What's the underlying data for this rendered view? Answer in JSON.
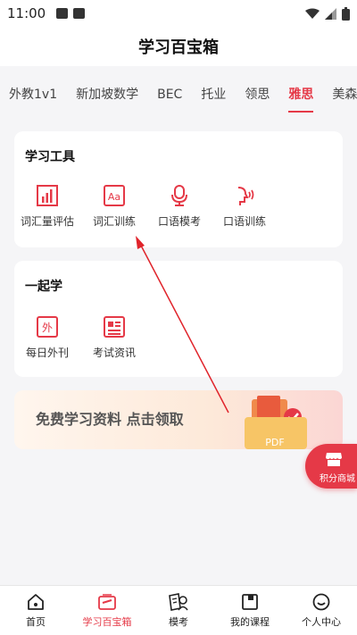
{
  "status": {
    "time": "11:00"
  },
  "header": {
    "title": "学习百宝箱"
  },
  "tabs": [
    {
      "label": "外教1v1"
    },
    {
      "label": "新加坡数学"
    },
    {
      "label": "BEC"
    },
    {
      "label": "托业"
    },
    {
      "label": "领思"
    },
    {
      "label": "雅思"
    },
    {
      "label": "美森"
    }
  ],
  "tools_card": {
    "title": "学习工具",
    "items": [
      {
        "label": "词汇量评估",
        "icon": "bar-chart-icon"
      },
      {
        "label": "词汇训练",
        "icon": "aa-icon"
      },
      {
        "label": "口语模考",
        "icon": "microphone-icon"
      },
      {
        "label": "口语训练",
        "icon": "speaking-icon"
      }
    ]
  },
  "together_card": {
    "title": "一起学",
    "items": [
      {
        "label": "每日外刊",
        "icon_text": "外",
        "icon": "daily-paper-icon"
      },
      {
        "label": "考试资讯",
        "icon": "news-icon"
      }
    ]
  },
  "banner": {
    "text": "免费学习资料  点击领取",
    "pdf_label": "PDF"
  },
  "float_button": {
    "label": "积分商城"
  },
  "bottom_nav": [
    {
      "label": "首页",
      "icon": "home-icon"
    },
    {
      "label": "学习百宝箱",
      "icon": "toolbox-icon"
    },
    {
      "label": "模考",
      "icon": "mock-exam-icon"
    },
    {
      "label": "我的课程",
      "icon": "course-icon"
    },
    {
      "label": "个人中心",
      "icon": "profile-icon"
    }
  ],
  "colors": {
    "accent": "#e53947",
    "background": "#f5f5f7"
  }
}
